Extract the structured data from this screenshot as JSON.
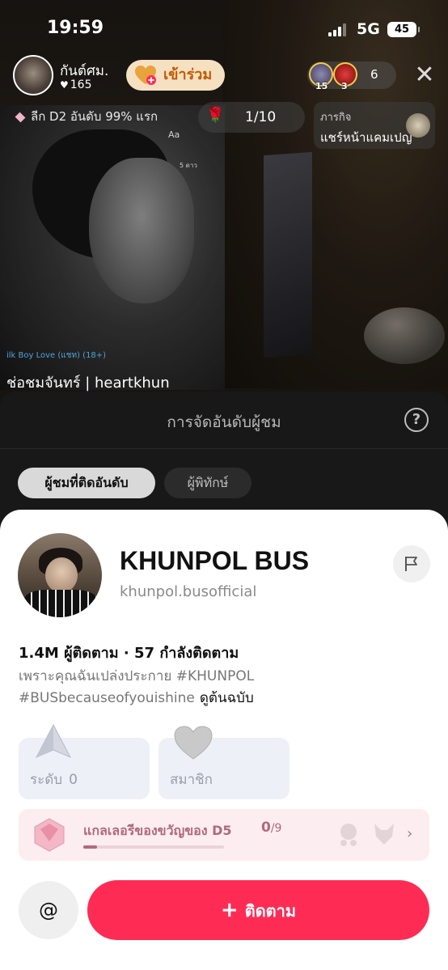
{
  "status_bar": {
    "time": "19:59",
    "network": "5G",
    "battery": "45"
  },
  "live": {
    "host_name": "กันต์ศม.",
    "host_likes": "165",
    "join_label": "เข้าร่วม",
    "viewer_badges": [
      "15",
      "3"
    ],
    "viewer_count": "6",
    "league_text": "ลีก D2 อันดับ 99% แรก",
    "rose_count": "1/10",
    "mission_title": "ภารกิจ",
    "mission_text": "แชร์หน้าแคมเปญ",
    "poster_tag": "ilk Boy Love (แชท) (18+)",
    "poster_caption": "ช่อชมจันทร์ | heartkhun",
    "poster_aa": "Aa",
    "poster_small": "5 ดาว"
  },
  "ranking": {
    "title": "การจัดอันดับผู้ชม",
    "tabs": [
      "ผู้ชมที่ติดอันดับ",
      "ผู้พิทักษ์"
    ]
  },
  "profile": {
    "name": "KHUNPOL BUS",
    "handle": "khunpol.busofficial",
    "stats": "1.4M ผู้ติดตาม · 57 กำลังติดตาม",
    "bio_line1": "เพราะคุณฉันเปล่งประกาย #KHUNPOL",
    "bio_line2": "#BUSbecauseofyouishine",
    "bio_original": "ดูต้นฉบับ",
    "level_label": "ระดับ",
    "level_value": "0",
    "member_label": "สมาชิก",
    "gift_title": "แกลเลอรีของขวัญของ D5",
    "gift_count": "0",
    "gift_total": "/9",
    "gift_progress": 0.1,
    "mention_label": "@",
    "follow_label": "ติดตาม"
  },
  "colors": {
    "follow": "#fe2c55",
    "join_bg": "#f6e0c2",
    "gift_bg": "#fcedf1",
    "stat_bg": "#eef0f7"
  }
}
